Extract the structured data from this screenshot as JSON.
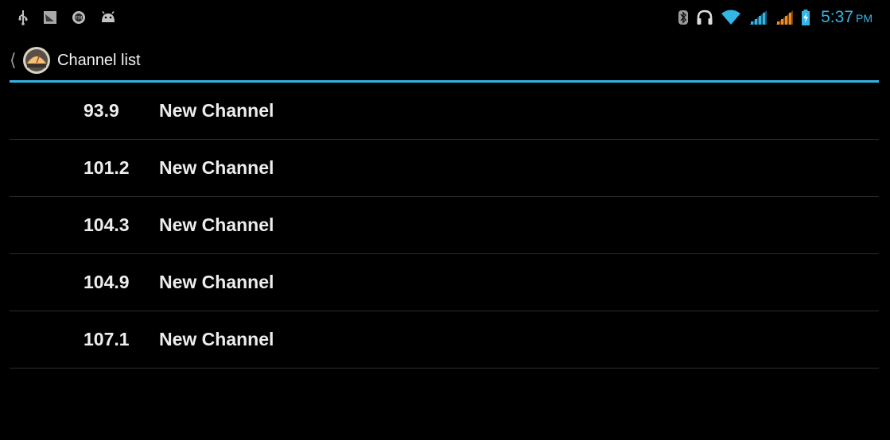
{
  "status_bar": {
    "left_icons": [
      "usb-icon",
      "screenshot-icon",
      "fm-radio-icon",
      "android-icon"
    ],
    "right_icons": [
      "bluetooth-icon",
      "headset-icon",
      "wifi-icon",
      "signal-icon",
      "signal-icon-2",
      "battery-charging-icon"
    ],
    "time": "5:37",
    "ampm": "PM",
    "accent_color": "#33b5e5",
    "signal_color": "#33b5e5",
    "signal2_color": "#f08a24"
  },
  "action_bar": {
    "title": "Channel list",
    "app_icon": "radio-app-icon",
    "divider_color": "#33b5e5"
  },
  "channels": [
    {
      "frequency": "93.9",
      "name": "New Channel"
    },
    {
      "frequency": "101.2",
      "name": "New Channel"
    },
    {
      "frequency": "104.3",
      "name": "New Channel"
    },
    {
      "frequency": "104.9",
      "name": "New Channel"
    },
    {
      "frequency": "107.1",
      "name": "New Channel"
    }
  ]
}
